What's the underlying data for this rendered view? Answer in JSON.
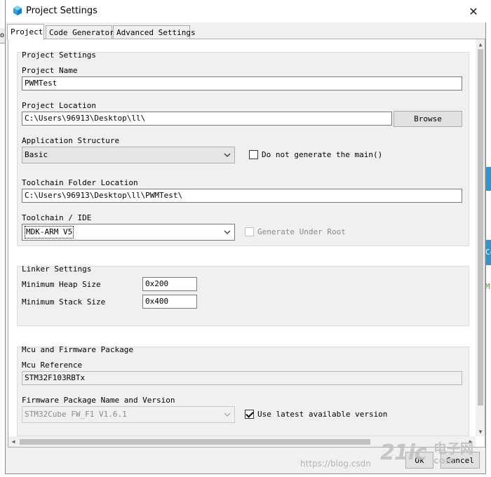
{
  "window": {
    "title": "Project Settings",
    "close_glyph": "✕",
    "icon": "cube-icon"
  },
  "tabs": [
    {
      "label": "Project",
      "active": true
    },
    {
      "label": "Code Generator",
      "active": false
    },
    {
      "label": "Advanced Settings",
      "active": false
    }
  ],
  "project_settings": {
    "group_title": "Project Settings",
    "project_name_label": "Project Name",
    "project_name_value": "PWMTest",
    "project_location_label": "Project Location",
    "project_location_value": "C:\\Users\\96913\\Desktop\\ll\\",
    "browse_label": "Browse",
    "application_structure_label": "Application Structure",
    "application_structure_value": "Basic",
    "do_not_generate_main_label": "Do not generate the main()",
    "do_not_generate_main_checked": false,
    "toolchain_folder_label": "Toolchain Folder Location",
    "toolchain_folder_value": "C:\\Users\\96913\\Desktop\\ll\\PWMTest\\",
    "toolchain_ide_label": "Toolchain / IDE",
    "toolchain_ide_value": "MDK-ARM V5",
    "generate_under_root_label": "Generate Under Root",
    "generate_under_root_checked": false
  },
  "linker_settings": {
    "group_title": "Linker Settings",
    "min_heap_label": "Minimum Heap Size",
    "min_heap_value": "0x200",
    "min_stack_label": "Minimum Stack Size",
    "min_stack_value": "0x400"
  },
  "mcu_firmware": {
    "group_title": "Mcu and Firmware Package",
    "mcu_reference_label": "Mcu Reference",
    "mcu_reference_value": "STM32F103RBTx",
    "firmware_label": "Firmware Package Name and Version",
    "firmware_value": "STM32Cube FW_F1 V1.6.1",
    "use_latest_label": "Use latest available version",
    "use_latest_checked": true
  },
  "footer": {
    "ok_label": "Ok",
    "cancel_label": "Cancel"
  },
  "background": {
    "left_tab_fragment": "o",
    "right_fragment_1": "Co",
    "right_fragment_2": "M"
  },
  "watermark": {
    "url": "https://blog.csdn",
    "logo": "21ic",
    "cn_line1": "电子网",
    "cn_line2": "com"
  },
  "colors": {
    "accent": "#1f9ad6",
    "window_bg": "#f0f0f0",
    "panel_bg": "#ffffff"
  }
}
